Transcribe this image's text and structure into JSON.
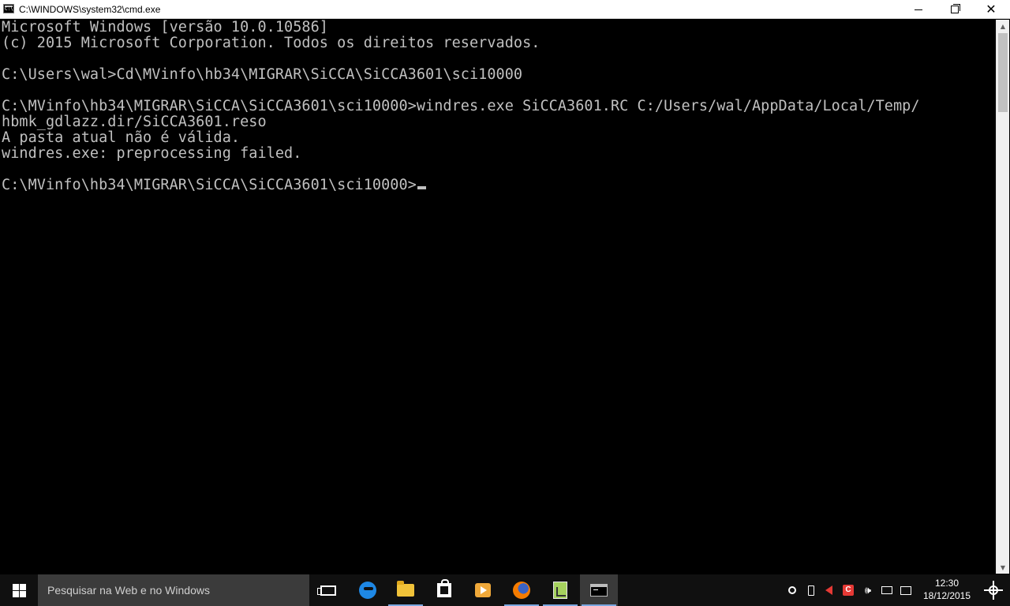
{
  "window": {
    "title": "C:\\WINDOWS\\system32\\cmd.exe",
    "icon": "cmd-icon",
    "controls": {
      "minimize": "minimize-icon",
      "maximize": "maximize-icon",
      "close": "✕"
    }
  },
  "console": {
    "lines": [
      "Microsoft Windows [versão 10.0.10586]",
      "(c) 2015 Microsoft Corporation. Todos os direitos reservados.",
      "",
      "C:\\Users\\wal>Cd\\MVinfo\\hb34\\MIGRAR\\SiCCA\\SiCCA3601\\sci10000",
      "",
      "C:\\MVinfo\\hb34\\MIGRAR\\SiCCA\\SiCCA3601\\sci10000>windres.exe SiCCA3601.RC C:/Users/wal/AppData/Local/Temp/",
      "hbmk_gdlazz.dir/SiCCA3601.reso",
      "A pasta atual não é válida.",
      "windres.exe: preprocessing failed.",
      "",
      "C:\\MVinfo\\hb34\\MIGRAR\\SiCCA\\SiCCA3601\\sci10000>"
    ],
    "text_color": "#c0c0c0",
    "background": "#000000"
  },
  "taskbar": {
    "search_placeholder": "Pesquisar na Web e no Windows",
    "pinned": [
      "task-view-icon",
      "edge-icon",
      "file-explorer-icon",
      "store-icon",
      "media-player-icon",
      "firefox-icon",
      "notepad-icon",
      "cmd-icon"
    ],
    "active_app": "cmd-icon",
    "clock": {
      "time": "12:30",
      "date": "18/12/2015"
    },
    "tray": [
      "record-icon",
      "usb-icon",
      "volume-muted-icon",
      "c-app-icon",
      "speaker-icon",
      "network-icon",
      "notifications-icon",
      "brightness-icon"
    ],
    "speaker_glyph": "🕪",
    "taskbar_color": "#101010",
    "accent": "#7aa7e0"
  }
}
